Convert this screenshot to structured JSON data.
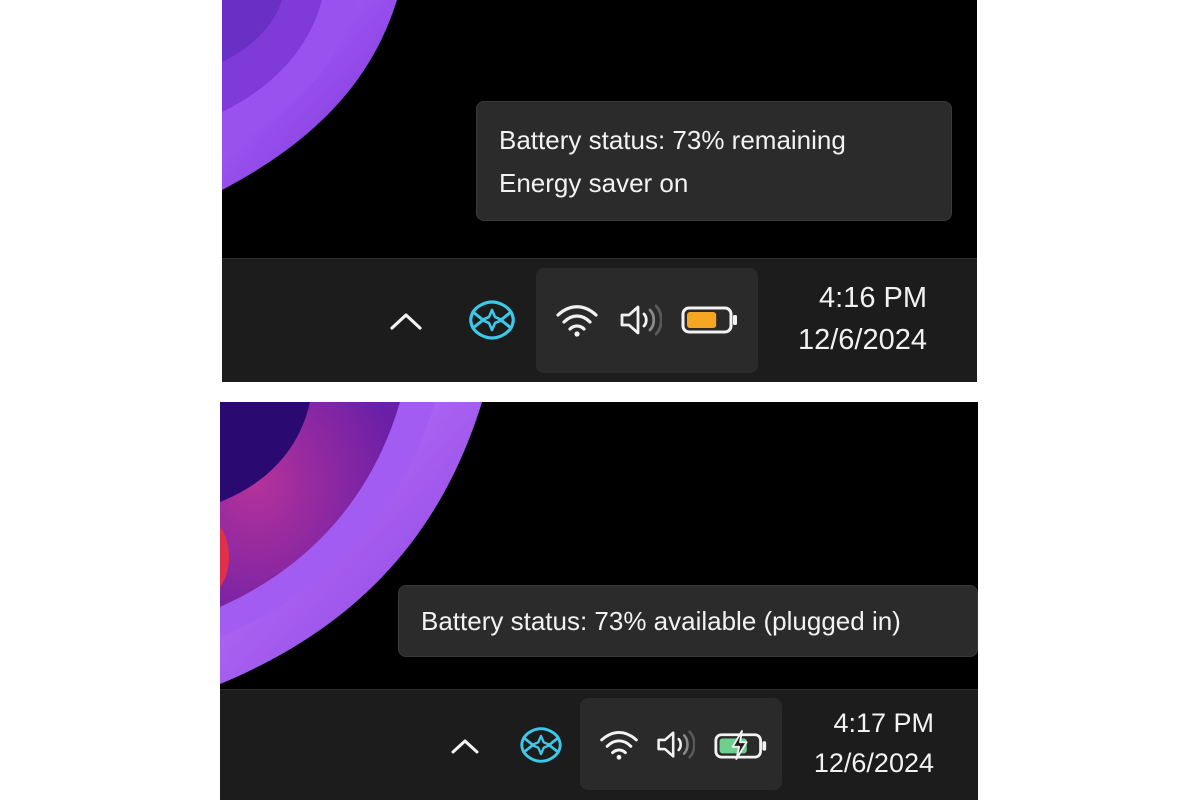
{
  "screenshots": [
    {
      "tooltip": {
        "lines": [
          "Battery status: 73% remaining",
          "Energy saver on"
        ]
      },
      "tray": {
        "icons": [
          "show-hidden-icons-chevron-icon",
          "copilot-icon",
          "wifi-icon",
          "volume-icon",
          "battery-icon"
        ],
        "battery_level": 0.73,
        "battery_fill_color": "#f5a623",
        "charging": false
      },
      "clock": {
        "time": "4:16 PM",
        "date": "12/6/2024"
      }
    },
    {
      "tooltip": {
        "lines": [
          "Battery status: 73% available (plugged in)"
        ]
      },
      "tray": {
        "icons": [
          "show-hidden-icons-chevron-icon",
          "copilot-icon",
          "wifi-icon",
          "volume-icon",
          "battery-charging-icon"
        ],
        "battery_level": 0.73,
        "battery_fill_color": "#6fcf8e",
        "charging": true
      },
      "clock": {
        "time": "4:17 PM",
        "date": "12/6/2024"
      }
    }
  ],
  "colors": {
    "taskbar": "#1c1c1c",
    "tooltip_background": "#2b2b2b",
    "text": "#f2f2f2",
    "copilot_accent": "#3cc8e8",
    "wallpaper_purple": "#8a3fe0"
  }
}
